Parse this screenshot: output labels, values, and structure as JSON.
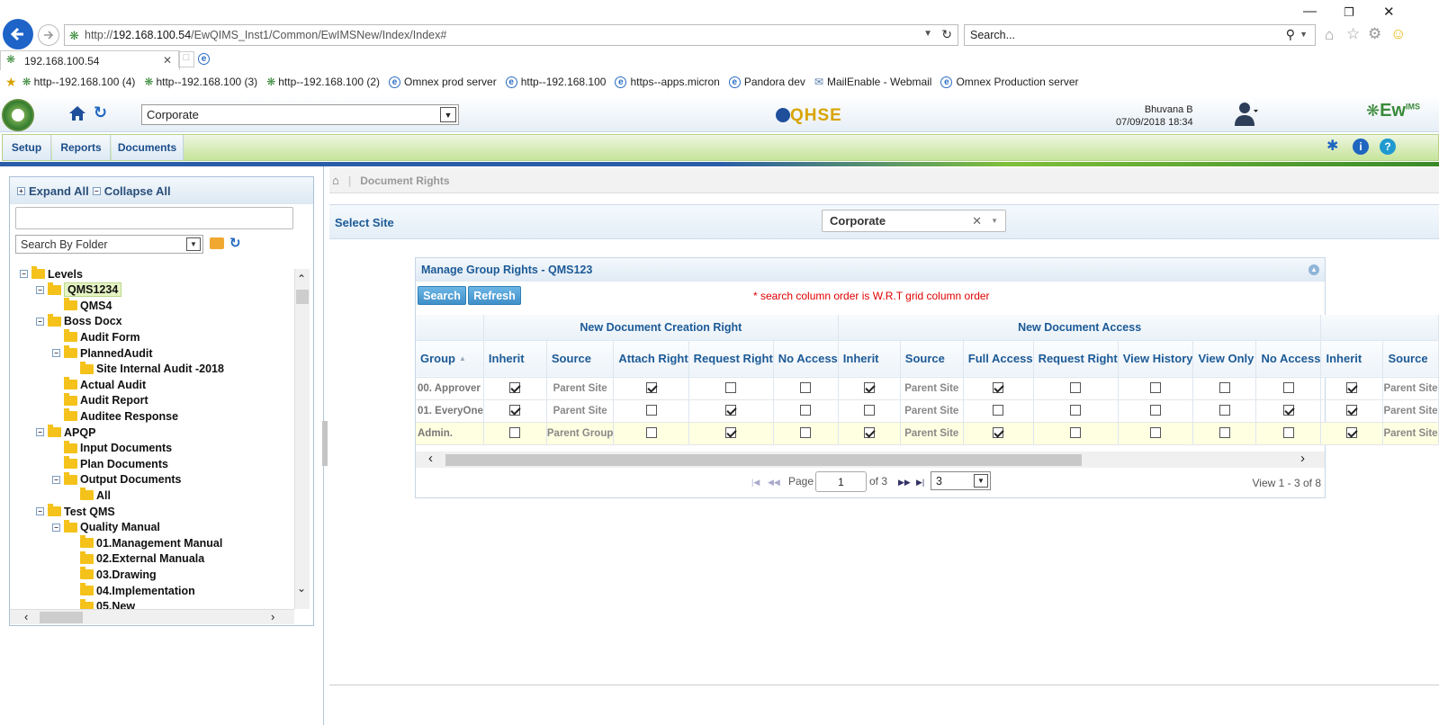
{
  "browser": {
    "url_prefix": "http://",
    "url_host": "192.168.100.54",
    "url_path": "/EwQIMS_Inst1/Common/EwIMSNew/Index/Index#",
    "search_placeholder": "Search...",
    "tab_title": "192.168.100.54",
    "favorites": [
      "http--192.168.100 (4)",
      "http--192.168.100 (3)",
      "http--192.168.100 (2)",
      "Omnex prod server",
      "http--192.168.100",
      "https--apps.micron",
      "Pandora dev",
      "MailEnable - Webmail",
      "Omnex Production server"
    ]
  },
  "header": {
    "site": "Corporate",
    "brand": "QHSE",
    "user_name": "Bhuvana B",
    "datetime": "07/09/2018 18:34",
    "logo_text": "Ew",
    "logo_sup": "IMS"
  },
  "menu": [
    "Setup",
    "Reports",
    "Documents"
  ],
  "tree_panel": {
    "expand_all": "Expand All",
    "collapse_all": "Collapse All",
    "search_by": "Search By Folder",
    "nodes": [
      {
        "label": "Levels",
        "level": 0,
        "toggle": "-"
      },
      {
        "label": "QMS1234",
        "level": 1,
        "toggle": "-",
        "selected": true
      },
      {
        "label": "QMS4",
        "level": 2,
        "toggle": ""
      },
      {
        "label": "Boss Docx",
        "level": 1,
        "toggle": "-"
      },
      {
        "label": "Audit Form",
        "level": 2,
        "toggle": ""
      },
      {
        "label": "PlannedAudit",
        "level": 2,
        "toggle": "-"
      },
      {
        "label": "Site Internal Audit -2018",
        "level": 3,
        "toggle": ""
      },
      {
        "label": "Actual Audit",
        "level": 2,
        "toggle": ""
      },
      {
        "label": "Audit Report",
        "level": 2,
        "toggle": ""
      },
      {
        "label": "Auditee Response",
        "level": 2,
        "toggle": ""
      },
      {
        "label": "APQP",
        "level": 1,
        "toggle": "-"
      },
      {
        "label": "Input Documents",
        "level": 2,
        "toggle": ""
      },
      {
        "label": "Plan Documents",
        "level": 2,
        "toggle": ""
      },
      {
        "label": "Output Documents",
        "level": 2,
        "toggle": "-"
      },
      {
        "label": "All",
        "level": 3,
        "toggle": ""
      },
      {
        "label": "Test QMS",
        "level": 1,
        "toggle": "-"
      },
      {
        "label": "Quality Manual",
        "level": 2,
        "toggle": "-"
      },
      {
        "label": "01.Management Manual",
        "level": 3,
        "toggle": ""
      },
      {
        "label": "02.External Manuala",
        "level": 3,
        "toggle": ""
      },
      {
        "label": "03.Drawing",
        "level": 3,
        "toggle": ""
      },
      {
        "label": "04.Implementation",
        "level": 3,
        "toggle": ""
      },
      {
        "label": "05.New",
        "level": 3,
        "toggle": ""
      }
    ]
  },
  "breadcrumb": {
    "current": "Document Rights"
  },
  "select_site": {
    "label": "Select Site",
    "value": "Corporate"
  },
  "grid": {
    "title": "Manage Group Rights - QMS123",
    "search_btn": "Search",
    "refresh_btn": "Refresh",
    "note": "* search column order is W.R.T grid column order",
    "group_headers": [
      "New Document Creation Right",
      "New Document Access"
    ],
    "columns": [
      "Group",
      "Inherit",
      "Source",
      "Attach Right",
      "Request Right",
      "No Access",
      "Inherit",
      "Source",
      "Full Access",
      "Request Right",
      "View History",
      "View Only",
      "No Access",
      "Inherit",
      "Source"
    ],
    "rows": [
      {
        "group": "00. Approver",
        "c": [
          true,
          "Parent Site",
          true,
          false,
          false,
          true,
          "Parent Site",
          true,
          false,
          false,
          false,
          false,
          true,
          "Parent Site"
        ]
      },
      {
        "group": "01. EveryOne",
        "c": [
          true,
          "Parent Site",
          false,
          true,
          false,
          false,
          "Parent Site",
          false,
          false,
          false,
          false,
          true,
          true,
          "Parent Site"
        ]
      },
      {
        "group": "Admin.",
        "c": [
          false,
          "Parent Group",
          false,
          true,
          false,
          true,
          "Parent Site",
          true,
          false,
          false,
          false,
          false,
          true,
          "Parent Site"
        ],
        "highlight": true
      }
    ],
    "pager": {
      "page_label": "Page",
      "page": "1",
      "of": "of 3",
      "page_size": "3",
      "view": "View 1 - 3 of 8"
    }
  }
}
